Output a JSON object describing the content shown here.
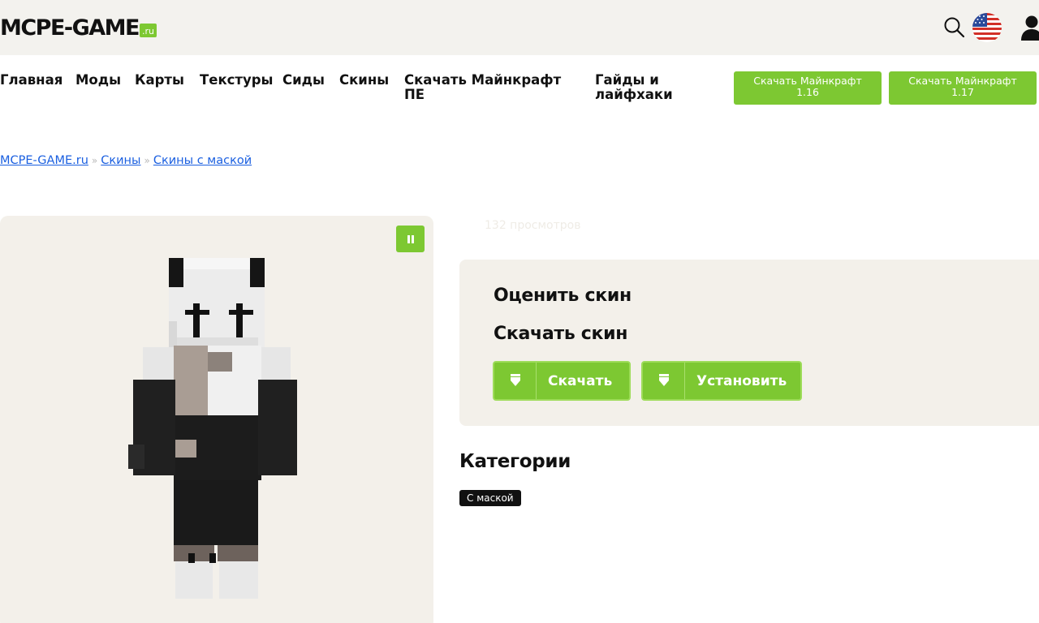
{
  "header": {
    "logo_text": "MCPE-GAME",
    "logo_suffix": ".ru"
  },
  "icons": {
    "search": "search-icon",
    "language": "us-flag-icon",
    "account": "user-icon"
  },
  "nav": {
    "items": [
      "Главная",
      "Моды",
      "Карты",
      "Текстуры",
      "Сиды",
      "Скины"
    ],
    "download_pe_line1": "Скачать Майнкрафт",
    "download_pe_line2": "ПЕ",
    "guides_line1": "Гайды и",
    "guides_line2": "лайфхаки",
    "btn1_line1": "Скачать Майнкрафт",
    "btn1_line2": "1.16",
    "btn2_line1": "Скачать Майнкрафт",
    "btn2_line2": "1.17"
  },
  "breadcrumb": {
    "home": "MCPE-GAME.ru",
    "sep": "»",
    "skins": "Скины",
    "current": "Скины с маской"
  },
  "views_text": "132 просмотров",
  "panel": {
    "rate_title": "Оценить скин",
    "download_title": "Скачать скин",
    "download_btn": "Скачать",
    "install_btn": "Установить"
  },
  "categories": {
    "title": "Категории",
    "tags": [
      "С маской"
    ]
  },
  "colors": {
    "accent": "#7dc832",
    "link": "#1a5fe0",
    "panel_bg": "#f3f0ea",
    "header_bg": "#f3f2ee"
  }
}
